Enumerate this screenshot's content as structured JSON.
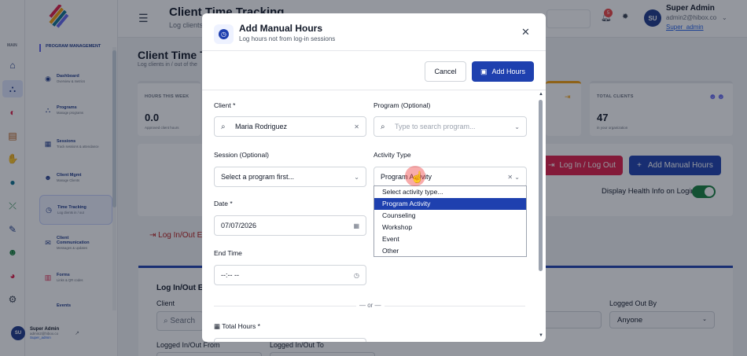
{
  "header": {
    "title": "Client Time Tracking",
    "subtitle": "Log clients",
    "notifications_count": "5",
    "user_initials": "SU",
    "user_name": "Super Admin",
    "user_email": "admin2@hibox.co",
    "user_role": "Super_admin"
  },
  "rail": {
    "main_label": "MAIN"
  },
  "sidebar": {
    "section": "PROGRAM MANAGEMENT",
    "items": [
      {
        "label": "Dashboard",
        "desc": "Overview & metrics",
        "icon": "gauge-icon"
      },
      {
        "label": "Programs",
        "desc": "Manage programs",
        "icon": "sitemap-icon"
      },
      {
        "label": "Sessions",
        "desc": "Track sessions & attendance",
        "icon": "calendar-icon"
      },
      {
        "label": "Client Mgmt",
        "desc": "Manage Clients",
        "icon": "users-icon"
      },
      {
        "label": "Time Tracking",
        "desc": "Log clients in / out",
        "icon": "clock-icon"
      },
      {
        "label": "Client Communication",
        "desc": "Messages & updates",
        "icon": "chat-icon"
      },
      {
        "label": "Forms",
        "desc": "Links & QR codes",
        "icon": "trash-icon"
      },
      {
        "label": "Events",
        "desc": "",
        "icon": "event-icon"
      }
    ],
    "user": {
      "initials": "SU",
      "name": "Super Admin",
      "email": "admin2@hibox.co",
      "role": "Super_admin"
    }
  },
  "page": {
    "title": "Client Time Tr",
    "subtitle": "Log clients in / out of the",
    "stats": [
      {
        "label": "HOURS THIS WEEK",
        "value": "0.0",
        "sub": "Approved client hours"
      },
      {
        "label": "TOTAL CLIENTS",
        "value": "47",
        "sub": "in your organization"
      }
    ],
    "log_in_out_button": "Log In / Log Out",
    "add_manual_button": "Add Manual Hours",
    "health_label": "Display Health Info on Login",
    "tab_label": "Log In/Out En",
    "entries_title": "Log In/Out En",
    "client_label": "Client",
    "search_placeholder": "Search",
    "logged_out_by_label": "Logged Out By",
    "logged_out_by_value": "Anyone",
    "from_label": "Logged In/Out From",
    "to_label": "Logged In/Out To"
  },
  "modal": {
    "title": "Add Manual Hours",
    "subtitle": "Log hours not from log-in sessions",
    "cancel": "Cancel",
    "add": "Add Hours",
    "client_label": "Client *",
    "client_value": "Maria Rodriguez",
    "program_label": "Program (Optional)",
    "program_placeholder": "Type to search program...",
    "session_label": "Session (Optional)",
    "session_value": "Select a program first...",
    "activity_label": "Activity Type",
    "activity_value": "Program Activity",
    "activity_options": [
      "Select activity type...",
      "Program Activity",
      "Counseling",
      "Workshop",
      "Event",
      "Other"
    ],
    "date_label": "Date *",
    "date_value": "07/07/2026",
    "end_label": "End Time",
    "end_value": "--:-- --",
    "or_text": "— or —",
    "total_label": "Total Hours *"
  }
}
